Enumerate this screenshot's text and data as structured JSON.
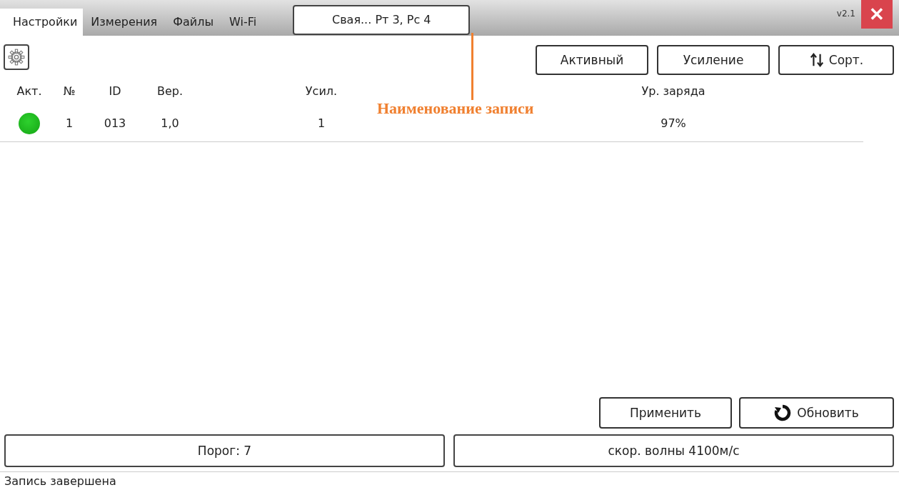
{
  "tabs": [
    {
      "label": "Настройки",
      "selected": true
    },
    {
      "label": "Измерения",
      "selected": false
    },
    {
      "label": "Файлы",
      "selected": false
    },
    {
      "label": "Wi-Fi",
      "selected": false
    }
  ],
  "record_name": "Свая... Рт 3, Рс 4",
  "version": "v2.1",
  "close_label": "✕",
  "toolbar_buttons": [
    {
      "label": "Активный",
      "kind": "plain"
    },
    {
      "label": "Усиление",
      "kind": "plain"
    },
    {
      "label": "Сорт.",
      "kind": "sort"
    }
  ],
  "table": {
    "columns": [
      "Акт.",
      "№",
      "ID",
      "Вер.",
      "Усил.",
      "Ур. заряда"
    ],
    "rows": [
      {
        "active": true,
        "number": "1",
        "id": "013",
        "version": "1,0",
        "gain": "1",
        "charge": "97%"
      }
    ]
  },
  "annotation": "Наименование записи",
  "action_buttons": [
    {
      "label": "Применить",
      "kind": "plain"
    },
    {
      "label": "Обновить",
      "kind": "refresh"
    }
  ],
  "fields": [
    "Порог: 7",
    "скор. волны 4100м/с"
  ],
  "status": "Запись завершена"
}
